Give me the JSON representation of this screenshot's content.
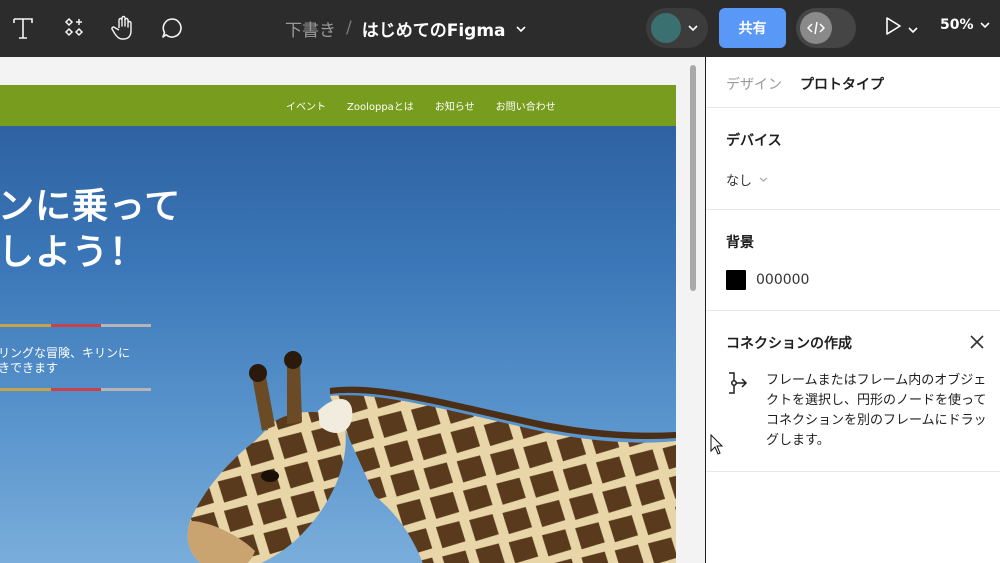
{
  "toolbar": {
    "tools": [
      "text-tool",
      "components-tool",
      "hand-tool",
      "comment-tool"
    ],
    "breadcrumb_draft": "下書き",
    "breadcrumb_separator": "/",
    "file_name": "はじめてのFigma",
    "share_label": "共有",
    "zoom": "50%",
    "avatar_color": "#3a7070",
    "share_color": "#5a98f8"
  },
  "canvas": {
    "site_nav": [
      "イベント",
      "Zooloppaとは",
      "お知らせ",
      "お問い合わせ"
    ],
    "nav_color": "#789c1e",
    "hero_line1": "ンに乗って",
    "hero_line2": "しよう！",
    "hero_text1": "リングな冒険、キリンに",
    "hero_text2": "きできます"
  },
  "panel": {
    "tabs": [
      "デザイン",
      "プロトタイプ"
    ],
    "active_tab": "プロトタイプ",
    "device_title": "デバイス",
    "device_value": "なし",
    "background_title": "背景",
    "background_color": "000000",
    "connection_title": "コネクションの作成",
    "connection_text": "フレームまたはフレーム内のオブジェクトを選択し、円形のノードを使ってコネクションを別のフレームにドラッグします。"
  }
}
